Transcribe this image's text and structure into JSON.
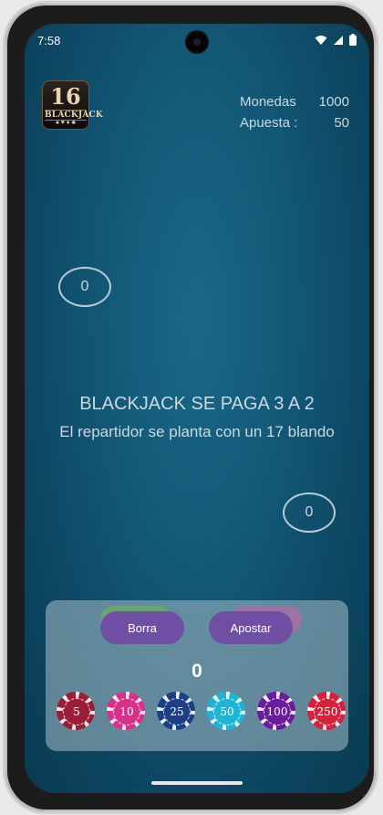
{
  "status_bar": {
    "time": "7:58",
    "icons": [
      "wifi-icon",
      "signal-icon",
      "battery-icon"
    ]
  },
  "logo": {
    "number": "16",
    "word": "BLACKJACK",
    "suits": "♠ ♥ ♦ ♣"
  },
  "stats": {
    "coins_label": "Monedas",
    "coins_value": "1000",
    "bet_label": "Apuesta :",
    "bet_value": "50"
  },
  "dealer_score": "0",
  "player_score": "0",
  "message": {
    "line1": "BLACKJACK SE PAGA 3 A 2",
    "line2": "El repartidor se planta con un 17 blando"
  },
  "controls": {
    "clear_label": "Borra",
    "bet_label": "Apostar",
    "current_bet": "0",
    "chips": [
      {
        "value": "5",
        "color": "#9b1d3a"
      },
      {
        "value": "10",
        "color": "#d6328a"
      },
      {
        "value": "25",
        "color": "#1c3f86"
      },
      {
        "value": "50",
        "color": "#1fb3d6"
      },
      {
        "value": "100",
        "color": "#6a1d9b"
      },
      {
        "value": "250",
        "color": "#d4213d"
      }
    ]
  }
}
